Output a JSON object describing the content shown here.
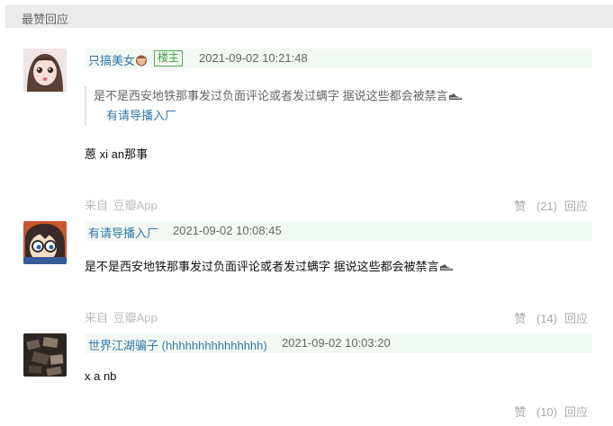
{
  "section": {
    "title": "最赞回应"
  },
  "comments": [
    {
      "author": "只搞美女",
      "badge": "楼主",
      "time": "2021-09-02 10:21:48",
      "quote": {
        "text": "是不是西安地铁那事发过负面评论或者发过螨字 据说这些都会被禁言",
        "author": "有请导播入厂"
      },
      "text": "蒽 xi an那事",
      "from_label": "来自",
      "from_app": "豆瓣App",
      "like_label": "赞",
      "likes": "(21)",
      "reply_label": "回应"
    },
    {
      "author": "有请导播入厂",
      "time": "2021-09-02 10:08:45",
      "text": "是不是西安地铁那事发过负面评论或者发过螨字 据说这些都会被禁言",
      "from_label": "来自",
      "from_app": "豆瓣App",
      "like_label": "赞",
      "likes": "(14)",
      "reply_label": "回应"
    },
    {
      "author": "世界江湖骗子 (hhhhhhhhhhhhhhh)",
      "time": "2021-09-02 10:03:20",
      "text": "x a nb",
      "like_label": "赞",
      "likes": "(10)",
      "reply_label": "回应"
    }
  ],
  "icons": {
    "monkey": "see-no-evil-monkey-icon",
    "shoe": "shoe-emoji-icon"
  }
}
